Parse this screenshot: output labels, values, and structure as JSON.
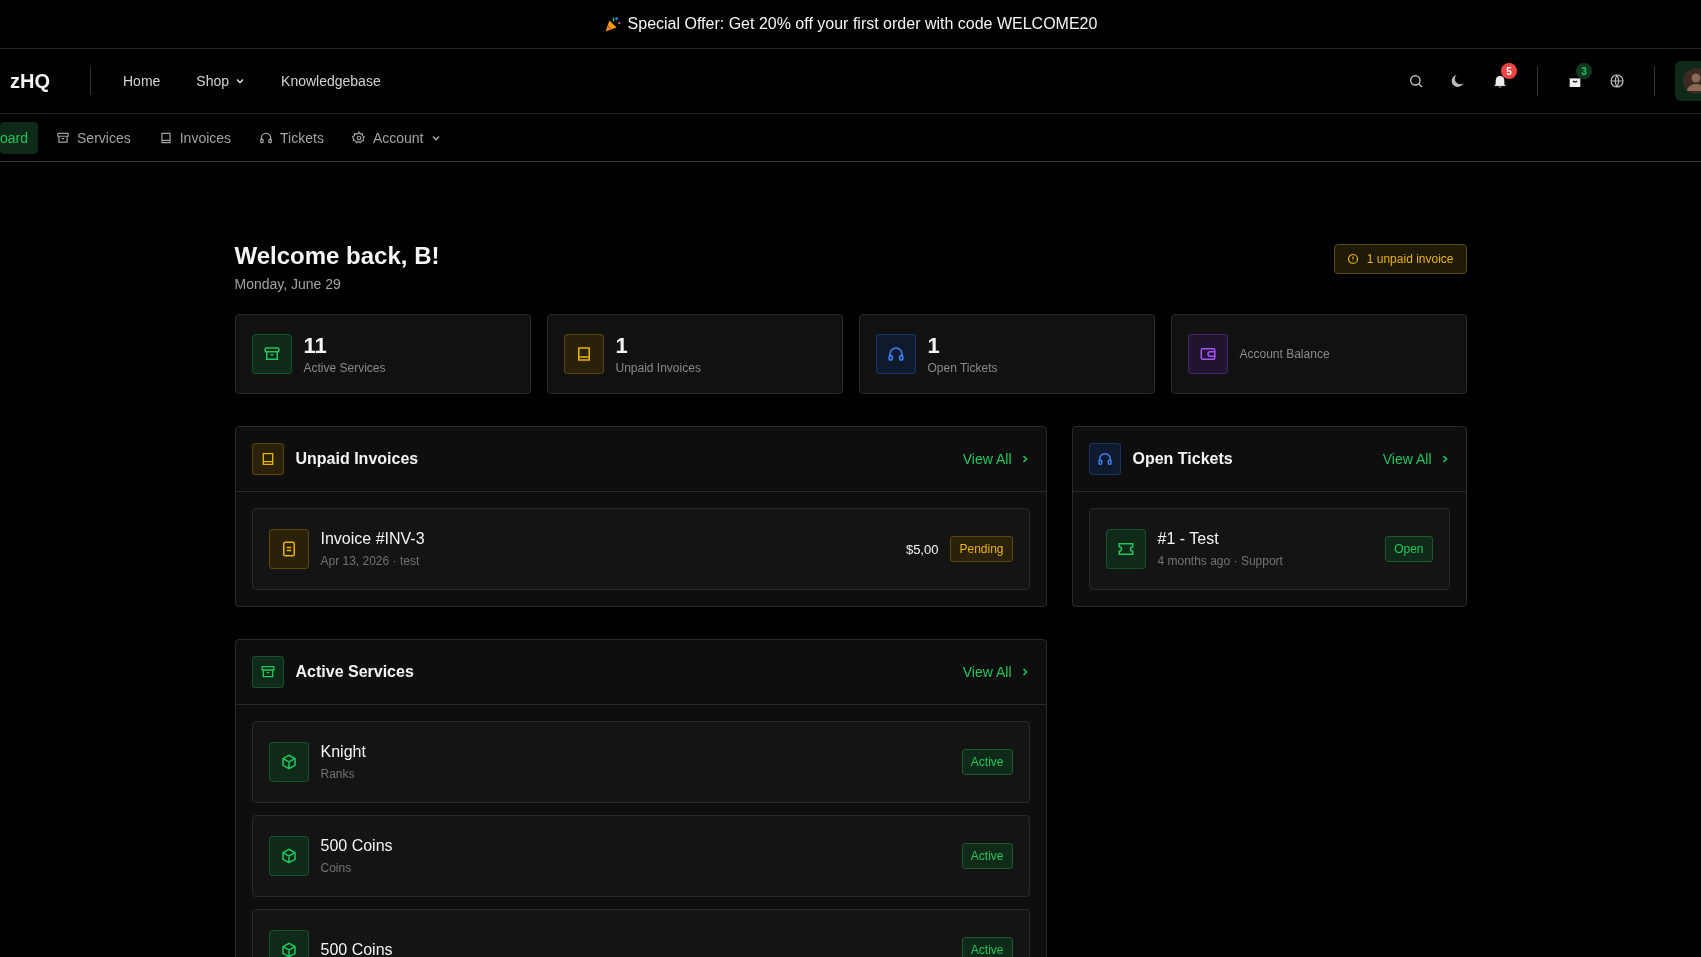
{
  "banner": {
    "text": "Special Offer: Get 20% off your first order with code WELCOME20"
  },
  "brand": "zHQ",
  "nav": [
    {
      "label": "Home",
      "dropdown": false
    },
    {
      "label": "Shop",
      "dropdown": true
    },
    {
      "label": "Knowledgebase",
      "dropdown": false
    }
  ],
  "header": {
    "notifications_badge": "5",
    "cart_badge": "3"
  },
  "subnav": [
    {
      "label": "oard",
      "kind": "plain",
      "selected": true,
      "dropdown": false
    },
    {
      "label": "Services",
      "kind": "services",
      "selected": false,
      "dropdown": false
    },
    {
      "label": "Invoices",
      "kind": "invoice",
      "selected": false,
      "dropdown": false
    },
    {
      "label": "Tickets",
      "kind": "headset",
      "selected": false,
      "dropdown": false
    },
    {
      "label": "Account",
      "kind": "gear",
      "selected": false,
      "dropdown": true
    }
  ],
  "welcome": {
    "title": "Welcome back, B!",
    "date": "Monday, June 29",
    "alert": "1 unpaid invoice"
  },
  "stats": [
    {
      "value": "11",
      "label": "Active Services",
      "kind": "services",
      "color": "#22c55e"
    },
    {
      "value": "1",
      "label": "Unpaid Invoices",
      "kind": "invoice",
      "color": "#eab308"
    },
    {
      "value": "1",
      "label": "Open Tickets",
      "kind": "headset",
      "color": "#3b82f6"
    },
    {
      "label": "Account Balance",
      "kind": "wallet",
      "color": "#a855f7"
    }
  ],
  "invoices": {
    "title": "Unpaid Invoices",
    "view_all": "View All",
    "items": [
      {
        "title": "Invoice #INV-3",
        "meta": "Apr 13, 2026 · test",
        "amount": "$5,00",
        "status": "Pending"
      }
    ]
  },
  "tickets": {
    "title": "Open Tickets",
    "view_all": "View All",
    "items": [
      {
        "title": "#1 - Test",
        "meta": "4 months ago · Support",
        "status": "Open"
      }
    ]
  },
  "services": {
    "title": "Active Services",
    "view_all": "View All",
    "items": [
      {
        "title": "Knight",
        "meta": "Ranks",
        "status": "Active"
      },
      {
        "title": "500 Coins",
        "meta": "Coins",
        "status": "Active"
      },
      {
        "title": "500 Coins",
        "status": "Active"
      }
    ]
  }
}
